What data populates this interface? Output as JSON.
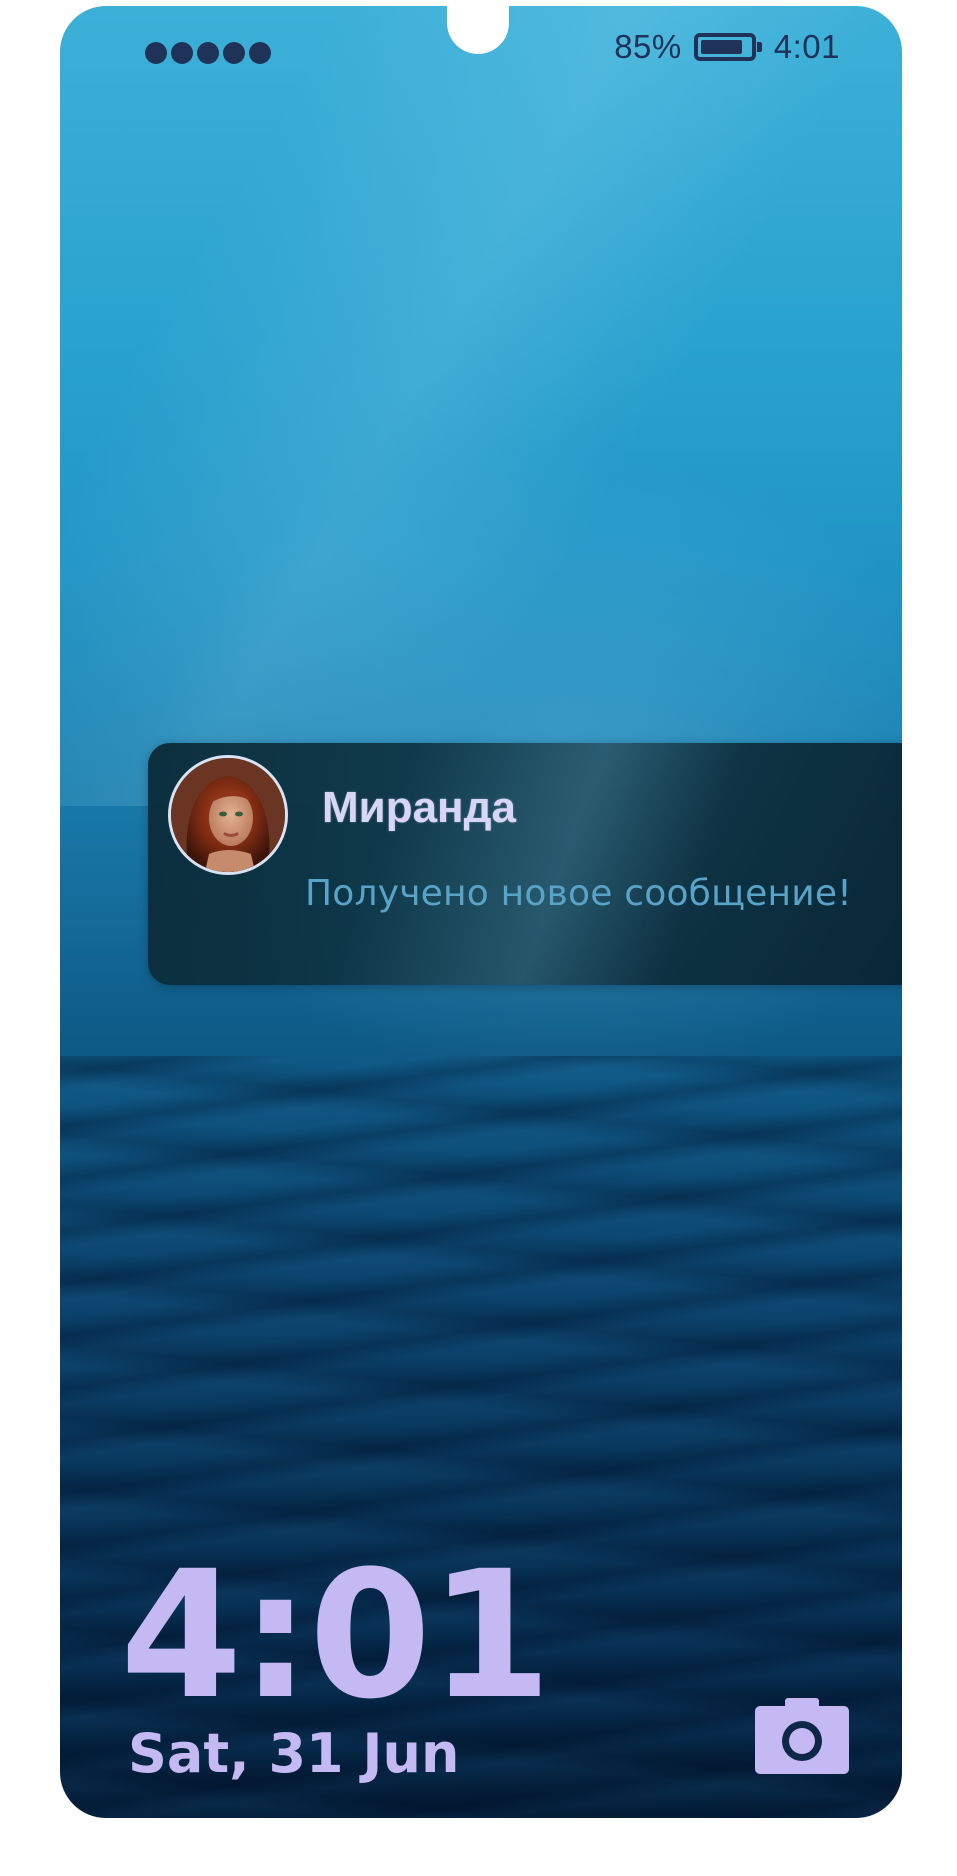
{
  "status_bar": {
    "signal_dots": 5,
    "battery_percent": "85%",
    "battery_level": 0.85,
    "time": "4:01"
  },
  "notification": {
    "sender": "Миранда",
    "message": "Получено новое сообщение!",
    "avatar_icon": "avatar-portrait"
  },
  "lock_screen": {
    "clock": "4:01",
    "date": "Sat, 31 Jun",
    "camera_icon": "camera-icon"
  },
  "colors": {
    "status_text": "#1f3358",
    "clock_text": "#c4b9f2",
    "sender_text": "#d9d6f5",
    "message_text": "#58a3c7"
  }
}
